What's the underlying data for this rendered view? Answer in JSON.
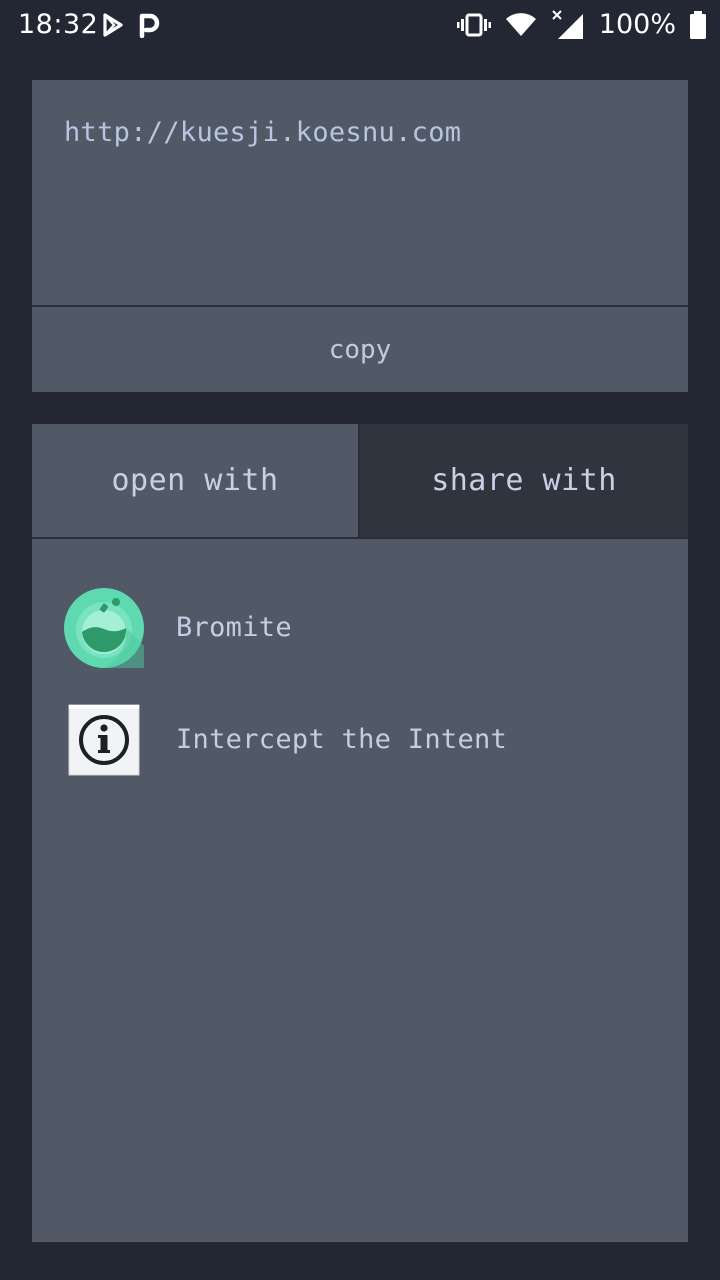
{
  "status_bar": {
    "time": "18:32",
    "battery": "100%",
    "icons": [
      "play-store-icon",
      "parking-icon",
      "vibrate-icon",
      "wifi-icon",
      "signal-icon",
      "battery-icon"
    ]
  },
  "url_panel": {
    "url": "http://kuesji.koesnu.com",
    "copy_label": "copy"
  },
  "tabs": [
    {
      "label": "open with",
      "selected": true
    },
    {
      "label": "share with",
      "selected": false
    }
  ],
  "apps": [
    {
      "label": "Bromite",
      "icon": "bromite-icon"
    },
    {
      "label": "Intercept the Intent",
      "icon": "info-icon"
    }
  ],
  "colors": {
    "background": "#232734",
    "panel": "#515967",
    "tab_inactive": "#30343f",
    "text": "#c7d0e2",
    "bromite_green": "#5ed9b0"
  }
}
